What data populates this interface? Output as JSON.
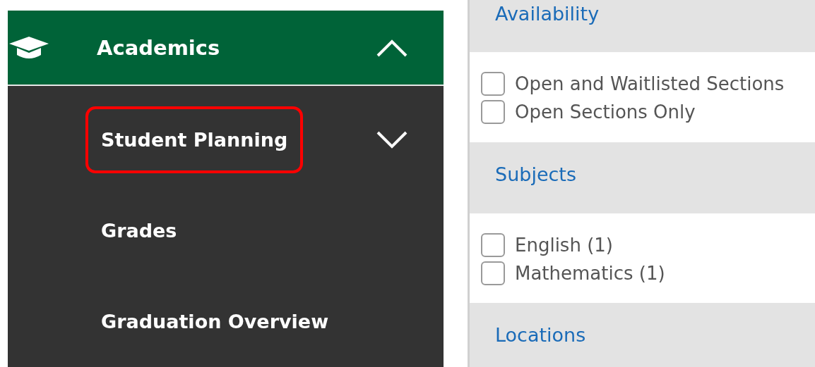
{
  "nav": {
    "header": {
      "label": "Academics",
      "expanded": true
    },
    "items": [
      {
        "label": "Student Planning",
        "expanded": false,
        "highlighted": true
      },
      {
        "label": "Grades",
        "highlighted": false
      },
      {
        "label": "Graduation Overview",
        "highlighted": false
      }
    ]
  },
  "filters": [
    {
      "title": "Availability",
      "options": [
        {
          "label": "Open and Waitlisted Sections",
          "checked": false
        },
        {
          "label": "Open Sections Only",
          "checked": false
        }
      ]
    },
    {
      "title": "Subjects",
      "options": [
        {
          "label": "English (1)",
          "checked": false
        },
        {
          "label": "Mathematics (1)",
          "checked": false
        }
      ]
    },
    {
      "title": "Locations"
    }
  ]
}
